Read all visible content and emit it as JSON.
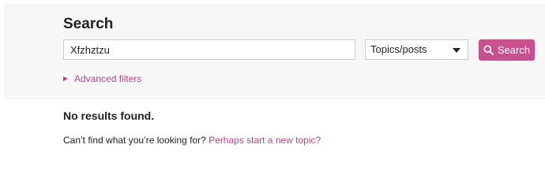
{
  "search": {
    "title": "Search",
    "query_value": "Xfzhztzu",
    "type_selected": "Topics/posts",
    "button_label": "Search",
    "advanced_filters_label": "Advanced filters"
  },
  "results": {
    "empty_message": "No results found.",
    "help_prefix": "Can’t find what you’re looking for? ",
    "help_link": "Perhaps start a new topic?"
  },
  "icons": {
    "search_button_icon": "search-icon",
    "select_caret": "caret-down-icon",
    "advanced_toggle": "triangle-right-icon"
  },
  "colors": {
    "accent": "#c5528d",
    "link": "#b04a82",
    "panel_bg": "#f7f7f7"
  }
}
